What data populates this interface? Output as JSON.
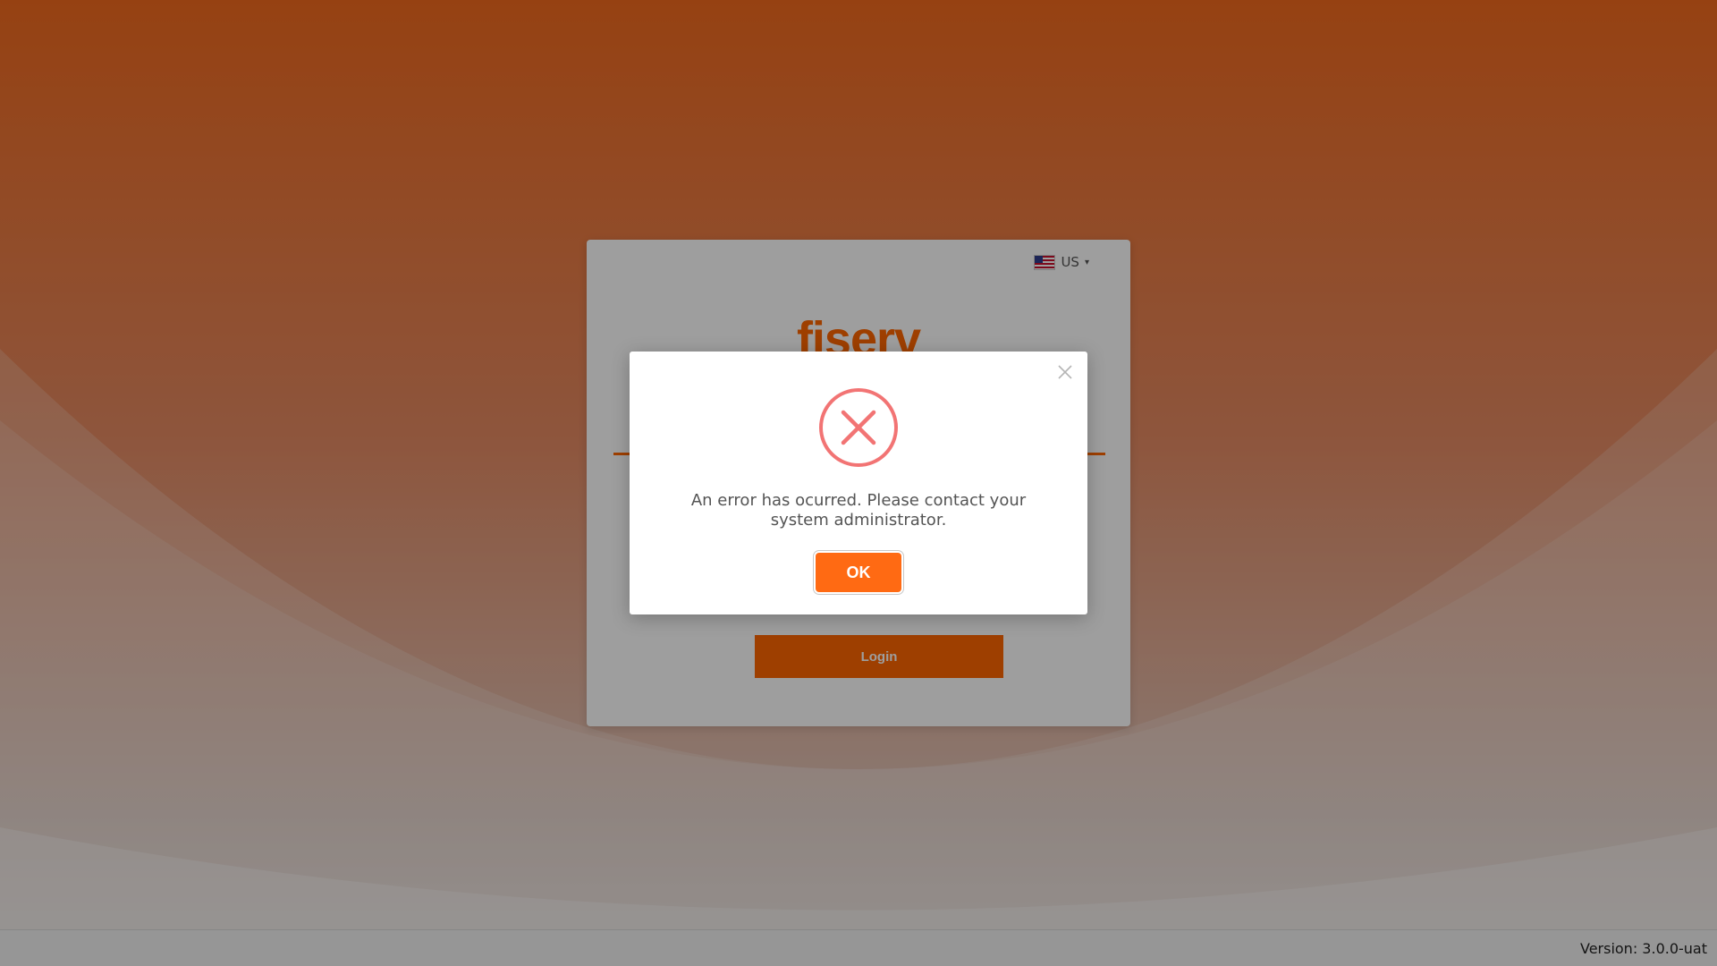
{
  "colors": {
    "brand_orange": "#ff6600",
    "error_red": "#f27474",
    "ok_button": "#ff6a13"
  },
  "language": {
    "flag_icon": "us-flag-icon",
    "selected": "US"
  },
  "brand": {
    "logo_text": "fiserv"
  },
  "login": {
    "button_label": "Login"
  },
  "modal": {
    "icon": "error-x-circle-icon",
    "message": "An error has ocurred. Please contact your system administrator.",
    "ok_label": "OK",
    "close_icon": "close-icon"
  },
  "footer": {
    "version": "Version: 3.0.0-uat"
  }
}
